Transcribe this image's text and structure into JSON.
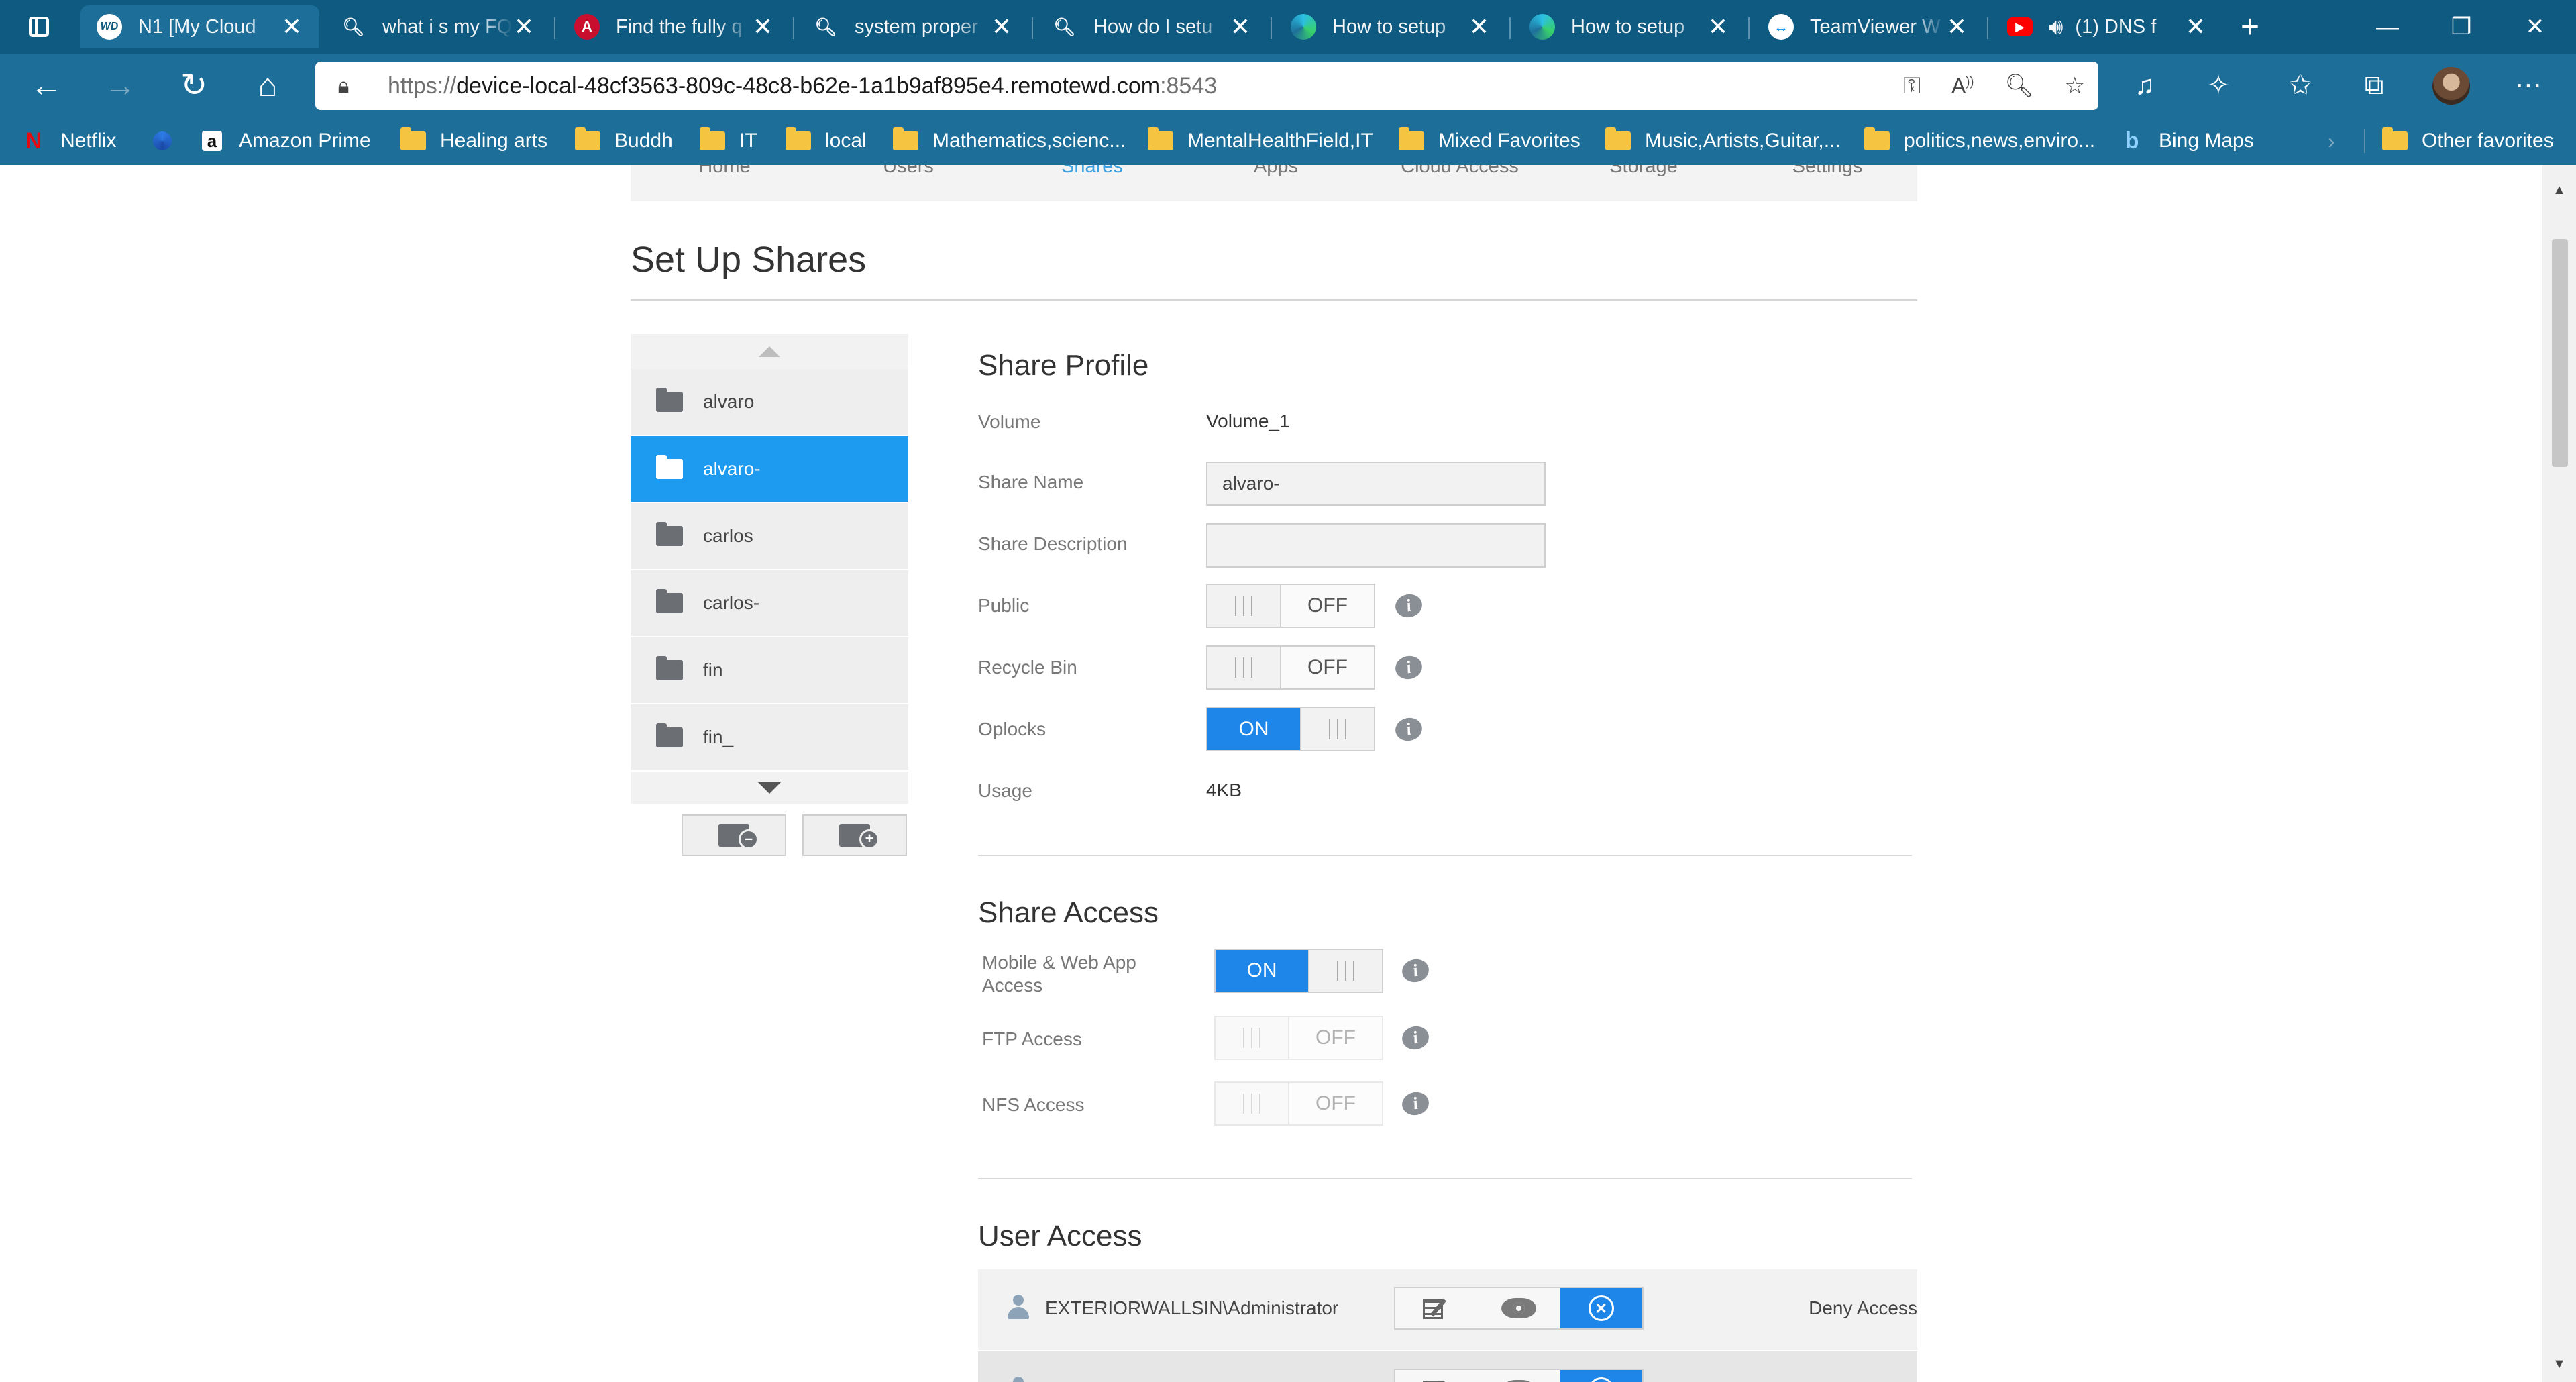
{
  "browser": {
    "tabs": [
      {
        "title": "N1 [My Cloud",
        "favicon": "wd-logo-icon",
        "active": true
      },
      {
        "title": "what i s my FQ",
        "favicon": "search-icon"
      },
      {
        "title": "Find the fully q",
        "favicon": "acrobat-icon"
      },
      {
        "title": "system proper",
        "favicon": "search-icon"
      },
      {
        "title": "How do I setu",
        "favicon": "search-icon"
      },
      {
        "title": "How to setup",
        "favicon": "edge-icon"
      },
      {
        "title": "How to setup",
        "favicon": "edge-icon"
      },
      {
        "title": "TeamViewer W",
        "favicon": "teamviewer-icon"
      },
      {
        "title": "(1) DNS f",
        "favicon": "youtube-icon"
      }
    ],
    "url": {
      "scheme": "https://",
      "host": "device-local-48cf3563-809c-48c8-b62e-1a1b9af895e4.remotewd.com",
      "port": ":8543"
    },
    "bookmarks": [
      {
        "label": "Netflix",
        "icon": "netflix-icon"
      },
      {
        "label": "",
        "icon": "edge-icon"
      },
      {
        "label": "Amazon Prime",
        "icon": "amazon-icon"
      },
      {
        "label": "Healing arts",
        "icon": "folder-icon"
      },
      {
        "label": "Buddh",
        "icon": "folder-icon"
      },
      {
        "label": "IT",
        "icon": "folder-icon"
      },
      {
        "label": "local",
        "icon": "folder-icon"
      },
      {
        "label": "Mathematics,scienc...",
        "icon": "folder-icon"
      },
      {
        "label": "MentalHealthField,IT",
        "icon": "folder-icon"
      },
      {
        "label": "Mixed Favorites",
        "icon": "folder-icon"
      },
      {
        "label": "Music,Artists,Guitar,...",
        "icon": "folder-icon"
      },
      {
        "label": "politics,news,enviro...",
        "icon": "folder-icon"
      },
      {
        "label": "Bing Maps",
        "icon": "bing-icon"
      }
    ],
    "other_favorites": "Other favorites"
  },
  "nav": {
    "items": [
      "Home",
      "Users",
      "Shares",
      "Apps",
      "Cloud Access",
      "Storage",
      "Settings"
    ],
    "active": "Shares"
  },
  "page": {
    "title": "Set Up Shares"
  },
  "shares": {
    "items": [
      "alvaro",
      "alvaro-",
      "carlos",
      "carlos-",
      "fin",
      "fin_"
    ],
    "selected": "alvaro-"
  },
  "profile": {
    "heading": "Share Profile",
    "volume_label": "Volume",
    "volume_value": "Volume_1",
    "name_label": "Share Name",
    "name_value": "alvaro-",
    "desc_label": "Share Description",
    "desc_value": "",
    "public_label": "Public",
    "public_state": "OFF",
    "recycle_label": "Recycle Bin",
    "recycle_state": "OFF",
    "oplocks_label": "Oplocks",
    "oplocks_state": "ON",
    "usage_label": "Usage",
    "usage_value": "4KB"
  },
  "access": {
    "heading": "Share Access",
    "mobile_label": "Mobile & Web App Access",
    "mobile_state": "ON",
    "ftp_label": "FTP Access",
    "ftp_state": "OFF",
    "nfs_label": "NFS Access",
    "nfs_state": "OFF"
  },
  "users": {
    "heading": "User Access",
    "rows": [
      {
        "name": "EXTERIORWALLSIN\\Administrator",
        "status": "Deny Access"
      }
    ]
  },
  "colors": {
    "accent": "#1d86e8",
    "selected_share": "#1d9bf0",
    "browser_frame": "#1d6f99"
  }
}
